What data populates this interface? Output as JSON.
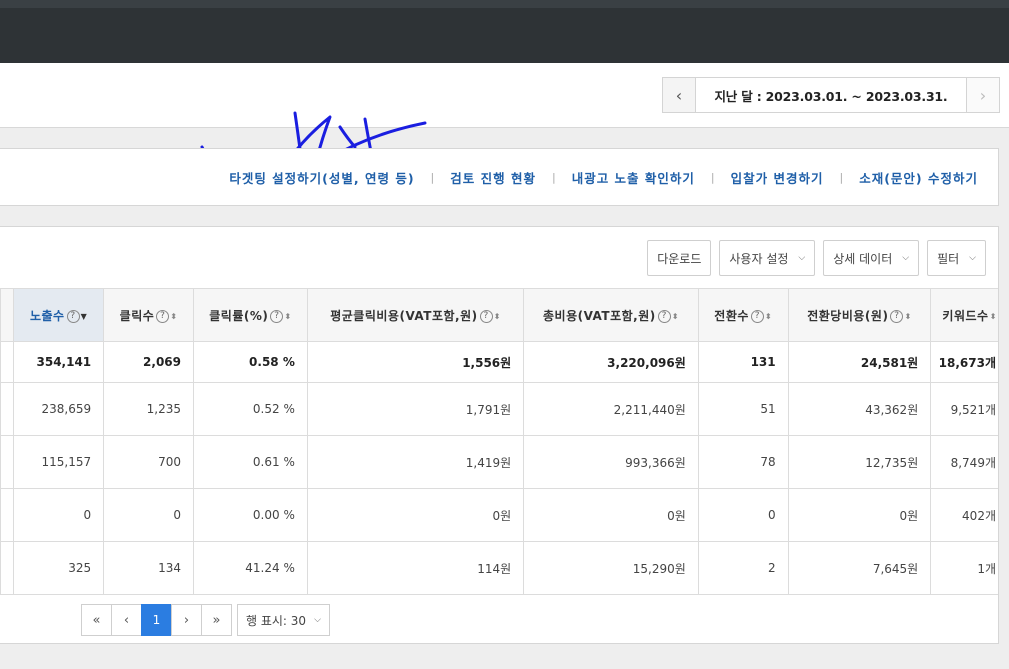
{
  "date_nav": {
    "prev_icon": "chevron-left-icon",
    "next_icon": "chevron-right-icon",
    "range_text": "지난 달 : 2023.03.01. ~ 2023.03.31."
  },
  "links": [
    "타겟팅 설정하기(성별, 연령 등)",
    "검토 진행 현황",
    "내광고 노출 확인하기",
    "입찰가 변경하기",
    "소재(문안) 수정하기"
  ],
  "toolbar": {
    "download": "다운로드",
    "user_settings": "사용자 설정",
    "detail_data": "상세 데이터",
    "filter": "필터"
  },
  "table": {
    "columns": [
      {
        "label": "노출수",
        "sorted": true
      },
      {
        "label": "클릭수"
      },
      {
        "label": "클릭률(%)"
      },
      {
        "label": "평균클릭비용(VAT포함,원)"
      },
      {
        "label": "총비용(VAT포함,원)"
      },
      {
        "label": "전환수"
      },
      {
        "label": "전환당비용(원)"
      },
      {
        "label": "키워드수"
      }
    ],
    "total": [
      "354,141",
      "2,069",
      "0.58 %",
      "1,556원",
      "3,220,096원",
      "131",
      "24,581원",
      "18,673개"
    ],
    "rows": [
      [
        "238,659",
        "1,235",
        "0.52 %",
        "1,791원",
        "2,211,440원",
        "51",
        "43,362원",
        "9,521개"
      ],
      [
        "115,157",
        "700",
        "0.61 %",
        "1,419원",
        "993,366원",
        "78",
        "12,735원",
        "8,749개"
      ],
      [
        "0",
        "0",
        "0.00 %",
        "0원",
        "0원",
        "0",
        "0원",
        "402개"
      ],
      [
        "325",
        "134",
        "41.24 %",
        "114원",
        "15,290원",
        "2",
        "7,645원",
        "1개"
      ]
    ]
  },
  "pagination": {
    "first": "«",
    "prev": "‹",
    "current": "1",
    "next": "›",
    "last": "»",
    "rows_per_page": "행 표시: 30"
  },
  "colors": {
    "accent": "#2b7de1",
    "link": "#1f5fa8",
    "topbar": "#2e3336"
  }
}
